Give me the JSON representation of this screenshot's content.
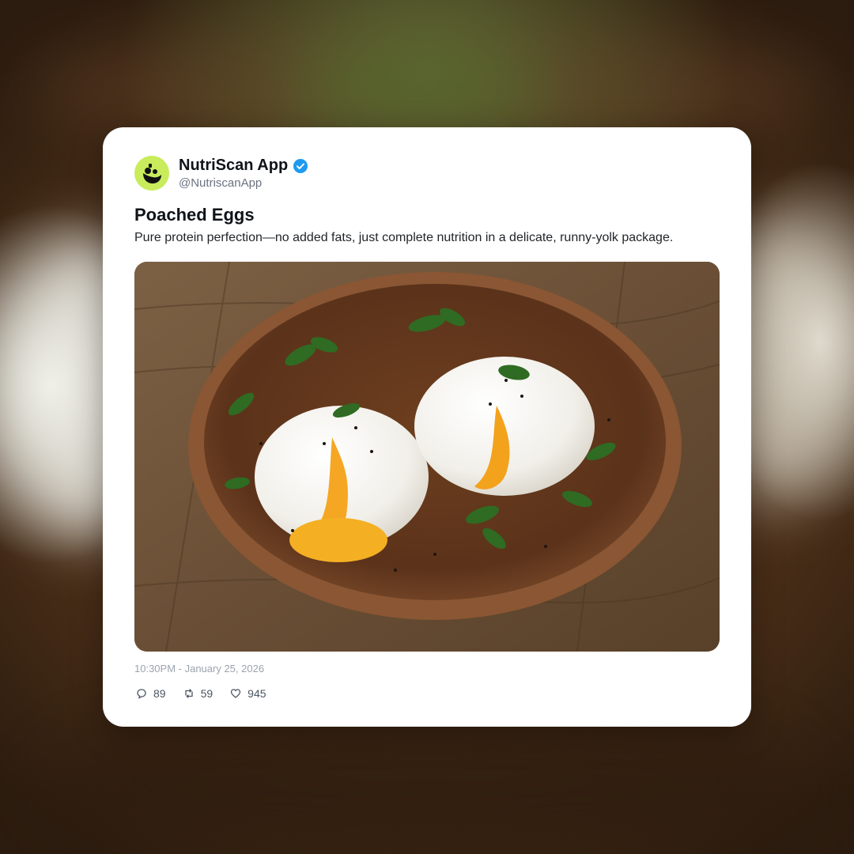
{
  "post": {
    "author": {
      "name": "NutriScan App",
      "handle": "@NutriscanApp",
      "verified": true,
      "avatar_icon": "nutriscan-logo-icon",
      "avatar_color": "#c8ec5c"
    },
    "title": "Poached Eggs",
    "description": "Pure protein perfection—no added fats, just complete nutrition in a delicate, runny-yolk package.",
    "image_subject": "poached-eggs-photo",
    "timestamp": "10:30PM - January 25, 2026",
    "stats": {
      "comments": "89",
      "reposts": "59",
      "likes": "945"
    }
  },
  "colors": {
    "verified_badge": "#1d9bf0",
    "card_background": "#ffffff",
    "text_primary": "#0f1419",
    "text_muted": "#9ca3af"
  }
}
